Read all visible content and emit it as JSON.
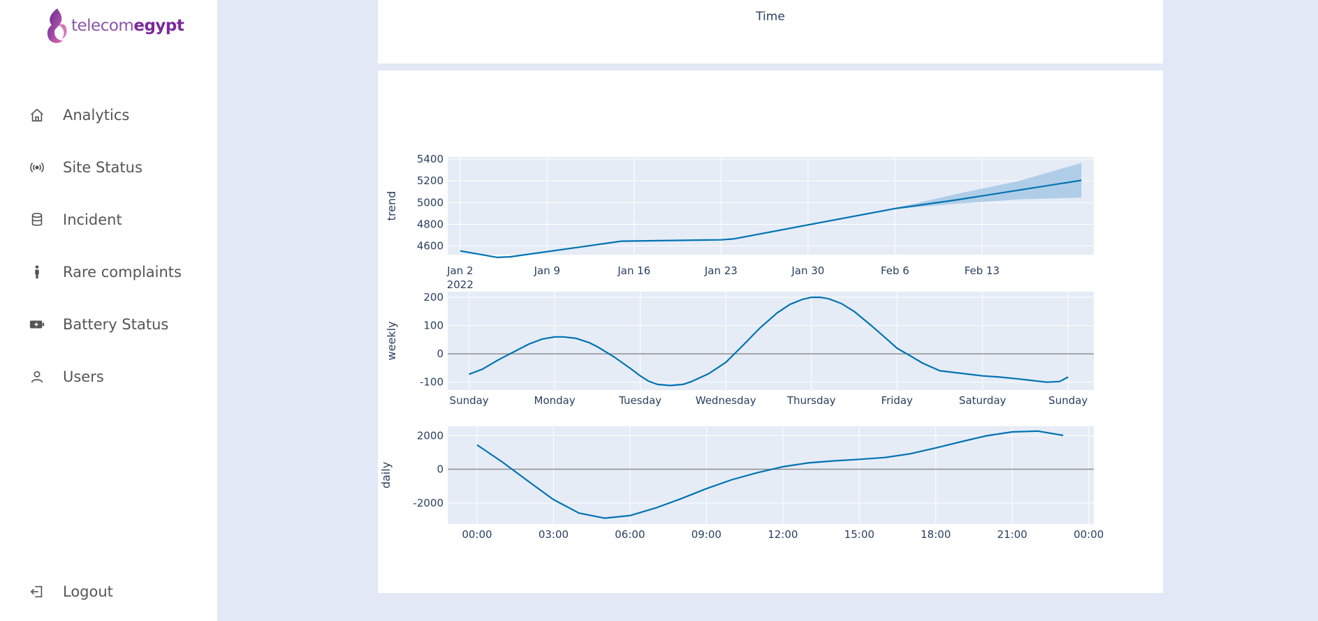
{
  "brand": {
    "name_light": "telecom",
    "name_bold": "egypt"
  },
  "nav": {
    "items": [
      {
        "label": "Analytics",
        "icon": "home-icon"
      },
      {
        "label": "Site Status",
        "icon": "broadcast-icon"
      },
      {
        "label": "Incident",
        "icon": "database-icon"
      },
      {
        "label": "Rare complaints",
        "icon": "person-standing-icon"
      },
      {
        "label": "Battery Status",
        "icon": "battery-charging-icon"
      },
      {
        "label": "Users",
        "icon": "user-icon"
      }
    ],
    "logout": {
      "label": "Logout",
      "icon": "logout-icon"
    }
  },
  "top_panel": {
    "axis_title": "Time"
  },
  "colors": {
    "line": "#0072b2",
    "band": "#9dc3e3",
    "plot_bg": "#e5ecf6",
    "axis_text": "#2a3f5f",
    "page_bg": "#e2e8f5"
  },
  "chart_data": [
    {
      "type": "line",
      "ylabel": "trend",
      "x_tick_labels": [
        "Jan 2",
        "Jan 9",
        "Jan 16",
        "Jan 23",
        "Jan 30",
        "Feb 6",
        "Feb 13"
      ],
      "x_tick_sublabel": "2022",
      "y_ticks": [
        4600,
        4800,
        5000,
        5200,
        5400
      ],
      "ylim": [
        4520,
        5420
      ],
      "xlim": [
        "2021-12-31",
        "2022-02-21"
      ],
      "grid": true,
      "series": [
        {
          "x": [
            "2022-01-01",
            "2022-01-04",
            "2022-01-05",
            "2022-01-10",
            "2022-01-14",
            "2022-01-22",
            "2022-01-23",
            "2022-02-05",
            "2022-02-10",
            "2022-02-20"
          ],
          "values": [
            4555,
            4495,
            4500,
            4580,
            4645,
            4657,
            4665,
            4945,
            5025,
            5205
          ]
        }
      ],
      "uncertainty": {
        "x": [
          "2022-02-05",
          "2022-02-10",
          "2022-02-15",
          "2022-02-20"
        ],
        "upper": [
          4950,
          5080,
          5200,
          5365
        ],
        "lower": [
          4940,
          4990,
          5030,
          5045
        ]
      }
    },
    {
      "type": "line",
      "ylabel": "weekly",
      "x_tick_labels": [
        "Sunday",
        "Monday",
        "Tuesday",
        "Wednesday",
        "Thursday",
        "Friday",
        "Saturday",
        "Sunday"
      ],
      "y_ticks": [
        -100,
        0,
        100,
        200
      ],
      "ylim": [
        -128,
        220
      ],
      "xlim": [
        -0.25,
        7.3
      ],
      "grid": true,
      "series": [
        {
          "x": [
            0,
            0.15,
            0.35,
            0.7,
            0.85,
            1.0,
            1.1,
            1.25,
            1.4,
            1.5,
            1.7,
            1.9,
            2.0,
            2.1,
            2.2,
            2.35,
            2.5,
            2.6,
            2.8,
            3.0,
            3.2,
            3.4,
            3.6,
            3.75,
            3.9,
            4.0,
            4.1,
            4.2,
            4.35,
            4.5,
            4.7,
            4.9,
            5.0,
            5.15,
            5.3,
            5.5,
            6.0,
            6.2,
            6.4,
            6.6,
            6.75,
            6.9,
            7.0
          ],
          "values": [
            -72,
            -55,
            -20,
            35,
            52,
            60,
            60,
            55,
            40,
            25,
            -12,
            -55,
            -78,
            -97,
            -108,
            -112,
            -108,
            -98,
            -70,
            -30,
            30,
            92,
            145,
            175,
            193,
            200,
            200,
            195,
            178,
            150,
            100,
            47,
            20,
            -6,
            -33,
            -60,
            -78,
            -82,
            -88,
            -95,
            -100,
            -98,
            -82
          ]
        }
      ]
    },
    {
      "type": "line",
      "ylabel": "daily",
      "x_tick_labels": [
        "00:00",
        "03:00",
        "06:00",
        "09:00",
        "12:00",
        "15:00",
        "18:00",
        "21:00",
        "00:00"
      ],
      "y_ticks": [
        -2000,
        0,
        2000
      ],
      "ylim": [
        -3250,
        2550
      ],
      "xlim": [
        -1.15,
        24.2
      ],
      "grid": true,
      "series": [
        {
          "x": [
            0,
            1,
            2,
            3,
            4,
            5,
            6,
            7,
            8,
            9,
            10,
            11,
            12,
            13,
            14,
            15,
            16,
            17,
            18,
            19,
            20,
            21,
            22,
            23
          ],
          "values": [
            1450,
            420,
            -700,
            -1800,
            -2600,
            -2900,
            -2750,
            -2300,
            -1750,
            -1150,
            -620,
            -200,
            150,
            380,
            500,
            590,
            700,
            920,
            1270,
            1640,
            1990,
            2220,
            2270,
            2010
          ]
        }
      ]
    }
  ]
}
